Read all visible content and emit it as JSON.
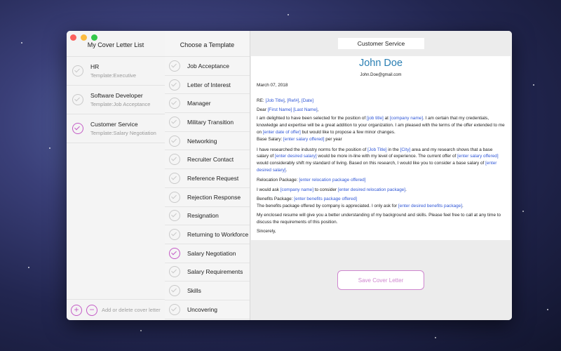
{
  "window": {
    "traffic_lights": [
      "close",
      "minimize",
      "zoom"
    ]
  },
  "colors": {
    "accent": "#c45bc6",
    "link": "#2f56d6",
    "name": "#2a7fb3"
  },
  "cover_letters": {
    "title": "My Cover Letter List",
    "items": [
      {
        "name": "HR",
        "template": "Template:Executive",
        "selected": false
      },
      {
        "name": "Software Developer",
        "template": "Template:Job Acceptance",
        "selected": false
      },
      {
        "name": "Customer Service",
        "template": "Template:Salary Negotiation",
        "selected": true
      }
    ],
    "add_icon": "plus-circle-icon",
    "remove_icon": "minus-circle-icon",
    "footer_text": "Add or delete cover letter"
  },
  "templates": {
    "title": "Choose a Template",
    "items": [
      {
        "label": "Job Acceptance",
        "selected": false
      },
      {
        "label": "Letter of Interest",
        "selected": false
      },
      {
        "label": "Manager",
        "selected": false
      },
      {
        "label": "Military Transition",
        "selected": false
      },
      {
        "label": "Networking",
        "selected": false
      },
      {
        "label": "Recruiter Contact",
        "selected": false
      },
      {
        "label": "Reference Request",
        "selected": false
      },
      {
        "label": "Rejection Response",
        "selected": false
      },
      {
        "label": "Resignation",
        "selected": false
      },
      {
        "label": "Returning to Workforce",
        "selected": false
      },
      {
        "label": "Salary Negotiation",
        "selected": true
      },
      {
        "label": "Salary Requirements",
        "selected": false
      },
      {
        "label": "Skills",
        "selected": false
      },
      {
        "label": "Uncovering",
        "selected": false
      }
    ]
  },
  "document": {
    "title": "Customer Service",
    "name": "John Doe",
    "email": "John.Doe@gmail.com",
    "date": "March 07, 2018",
    "re_prefix": "RE: ",
    "re_job_title": "[Job Title]",
    "re_sep1": ", ",
    "re_ref": "[Ref#]",
    "re_sep2": ", ",
    "re_date": "[Date]",
    "dear_prefix": "Dear ",
    "first_name": "[First Name]",
    "last_name": "[Last Name]",
    "dear_suffix": ",",
    "p1_a": "I am delighted to have been selected for the position of ",
    "p1_job": "[job title]",
    "p1_b": " at ",
    "p1_company": "[company name]",
    "p1_c": ". I am certain that my credentials, knowledge and expertise will be a great addition to your organization. I am pleased with the terms of the offer extended to me on ",
    "p1_date": "[enter date of offer]",
    "p1_d": " but would like to propose a few minor changes.",
    "base_label": "Base Salary: ",
    "base_value": "[enter salary offered]",
    "base_suffix": " per year",
    "p2_a": "I have researched the industry norms for the position of ",
    "p2_job": "[Job Title]",
    "p2_b": " in the ",
    "p2_city": "[City]",
    "p2_c": " area and my research shows that a base salary of ",
    "p2_desired": "[enter desired salary]",
    "p2_d": " would be more in-line with my level of experience. The current offer of ",
    "p2_offered": "[enter salary offered]",
    "p2_e": " would considerably shift my standard of living. Based on this research, I would like you to consider a base salary of ",
    "p2_desired2": "[enter desired salary]",
    "p2_f": ".",
    "reloc_label": "Relocation Package: ",
    "reloc_value": "[enter relocation package offered]",
    "p3_a": "I would ask ",
    "p3_company": "[company name]",
    "p3_b": " to consider ",
    "p3_reloc": "[enter desired relocation package]",
    "p3_c": ".",
    "benefits_label": "Benefits Package: ",
    "benefits_value": "[enter benefits package offered]",
    "p4_a": "The benefits package offered by company is appreciated. I only ask for ",
    "p4_benefits": "[enter desired benefits package]",
    "p4_b": ".",
    "p5": "My enclosed resume will give you a better understanding of my background and skills. Please feel free to call at any time to discuss the requirements of this position.",
    "closing": "Sincerely,"
  },
  "save_button": "Save Cover Letter"
}
